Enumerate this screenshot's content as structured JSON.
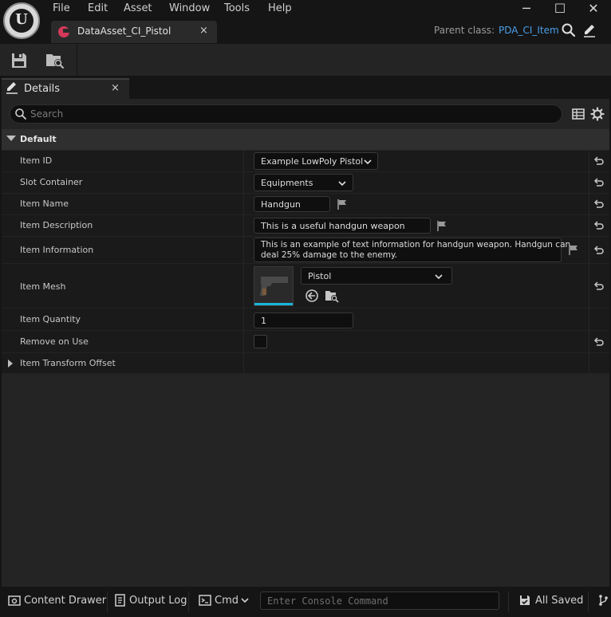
{
  "menu": [
    "File",
    "Edit",
    "Asset",
    "Window",
    "Tools",
    "Help"
  ],
  "window_controls": {
    "minimize": "─",
    "maximize": "☐",
    "close": "✕"
  },
  "asset_tab": {
    "label": "DataAsset_CI_Pistol",
    "close": "×"
  },
  "parent_class": {
    "label": "Parent class:",
    "value": "PDA_CI_Item"
  },
  "details_tab": {
    "label": "Details",
    "close": "×"
  },
  "search": {
    "placeholder": "Search"
  },
  "category": {
    "label": "Default"
  },
  "properties": {
    "item_id": {
      "label": "Item ID",
      "value": "Example LowPoly Pistol"
    },
    "slot_container": {
      "label": "Slot Container",
      "value": "Equipments"
    },
    "item_name": {
      "label": "Item Name",
      "value": "Handgun"
    },
    "item_description": {
      "label": "Item Description",
      "value": "This is a useful handgun weapon"
    },
    "item_information": {
      "label": "Item Information",
      "line1": "This is an example of text information for handgun weapon. Handgun can",
      "line2": "deal 25% damage to the enemy."
    },
    "item_mesh": {
      "label": "Item Mesh",
      "value": "Pistol"
    },
    "item_quantity": {
      "label": "Item Quantity",
      "value": "1"
    },
    "remove_on_use": {
      "label": "Remove on Use",
      "checked": false
    },
    "item_transform_offset": {
      "label": "Item Transform Offset"
    }
  },
  "statusbar": {
    "content_drawer": "Content Drawer",
    "output_log": "Output Log",
    "cmd": "Cmd",
    "console_placeholder": "Enter Console Command",
    "all_saved": "All Saved"
  },
  "colors": {
    "accent_blue": "#4a9fe8",
    "asset_icon": "#d43a5a",
    "thumbnail_bar": "#19b5d8"
  }
}
